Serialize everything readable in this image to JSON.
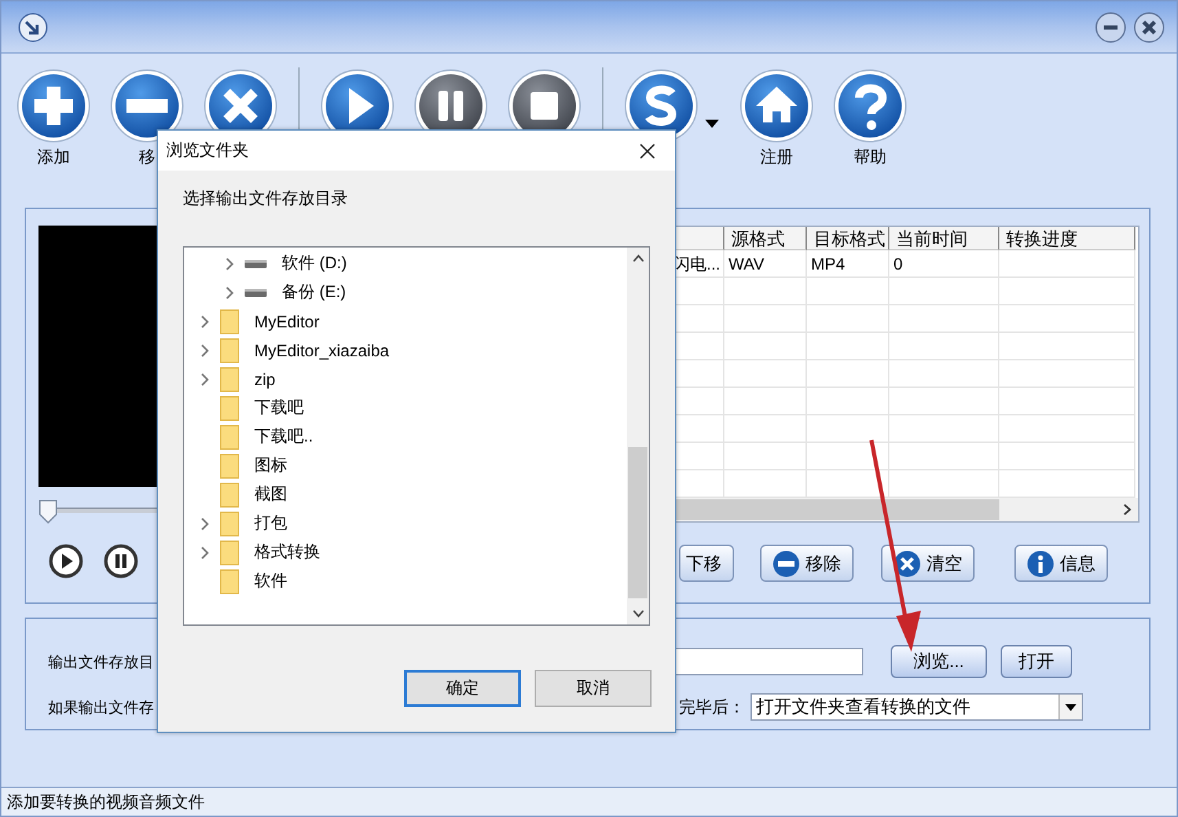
{
  "toolbar": [
    [
      {
        "kind": "add",
        "label": "添加"
      },
      {
        "kind": "remove",
        "label": "移"
      },
      {
        "kind": "delete"
      }
    ],
    [
      {
        "kind": "play"
      },
      {
        "kind": "pause"
      },
      {
        "kind": "stop"
      }
    ],
    [
      {
        "kind": "skin"
      },
      {
        "kind": "dropdown"
      },
      {
        "kind": "home",
        "label": "注册"
      },
      {
        "kind": "help",
        "label": "帮助"
      }
    ]
  ],
  "player": {
    "level": 0
  },
  "table": {
    "columns": [
      "",
      "源格式",
      "目标格式",
      "当前时间",
      "转换进度"
    ],
    "rows": [
      {
        "cells": [
          "闪电...",
          "WAV",
          "MP4",
          "0"
        ]
      }
    ]
  },
  "actions": [
    {
      "kind": "down",
      "label": "下移"
    },
    {
      "kind": "remove",
      "label": "移除"
    },
    {
      "kind": "clear",
      "label": "清空"
    },
    {
      "kind": "info",
      "label": "信息"
    }
  ],
  "output": {
    "dir_label": "输出文件存放目",
    "browse": "浏览...",
    "open": "打开",
    "exists_label": "如果输出文件存",
    "after_label": "完毕后：",
    "after_value": "打开文件夹查看转换的文件"
  },
  "dialog": {
    "title": "浏览文件夹",
    "prompt": "选择输出文件存放目录",
    "tree": [
      {
        "kind": "drive",
        "label": "软件 (D:)",
        "expandable": true
      },
      {
        "kind": "drive",
        "label": "备份 (E:)",
        "expandable": true
      },
      {
        "kind": "folder",
        "label": "MyEditor",
        "expandable": true
      },
      {
        "kind": "folder",
        "label": "MyEditor_xiazaiba",
        "expandable": true
      },
      {
        "kind": "folder",
        "label": "zip",
        "expandable": true
      },
      {
        "kind": "folder",
        "label": "下载吧",
        "expandable": false
      },
      {
        "kind": "folder",
        "label": "下载吧..",
        "expandable": false
      },
      {
        "kind": "folder",
        "label": "图标",
        "expandable": false
      },
      {
        "kind": "folder",
        "label": "截图",
        "expandable": false
      },
      {
        "kind": "folder",
        "label": "打包",
        "expandable": true
      },
      {
        "kind": "folder",
        "label": "格式转换",
        "expandable": true
      },
      {
        "kind": "folder",
        "label": "软件",
        "expandable": false
      }
    ],
    "ok": "确定",
    "cancel": "取消"
  },
  "status": "添加要转换的视频音频文件"
}
